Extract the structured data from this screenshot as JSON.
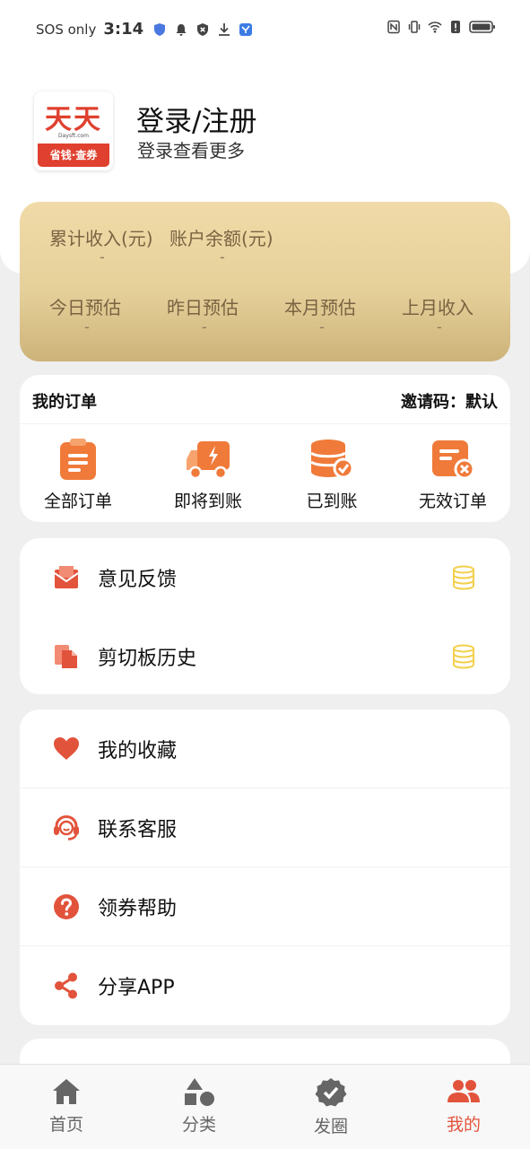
{
  "status_bar": {
    "carrier": "SOS only",
    "time": "3:14"
  },
  "profile": {
    "logo_text": "天天",
    "logo_small": "Daysft.com",
    "logo_band": "省钱·查券",
    "title": "登录/注册",
    "subtitle": "登录查看更多"
  },
  "earnings": {
    "total_income_label": "累计收入(元)",
    "total_income_value": "-",
    "balance_label": "账户余额(元)",
    "balance_value": "-",
    "stats": [
      {
        "label": "今日预估",
        "value": "-"
      },
      {
        "label": "昨日预估",
        "value": "-"
      },
      {
        "label": "本月预估",
        "value": "-"
      },
      {
        "label": "上月收入",
        "value": "-"
      }
    ]
  },
  "orders": {
    "title": "我的订单",
    "invite_code": "邀请码：默认",
    "items": [
      {
        "label": "全部订单",
        "icon": "order-list-icon"
      },
      {
        "label": "即将到账",
        "icon": "delivery-truck-icon"
      },
      {
        "label": "已到账",
        "icon": "coins-check-icon"
      },
      {
        "label": "无效订单",
        "icon": "invalid-order-icon"
      }
    ]
  },
  "menu_group_1": [
    {
      "label": "意见反馈",
      "icon": "feedback-mail-icon"
    },
    {
      "label": "剪切板历史",
      "icon": "clipboard-icon"
    }
  ],
  "menu_group_2": [
    {
      "label": "我的收藏",
      "icon": "heart-icon"
    },
    {
      "label": "联系客服",
      "icon": "headset-icon"
    },
    {
      "label": "领券帮助",
      "icon": "help-icon"
    },
    {
      "label": "分享APP",
      "icon": "share-icon"
    }
  ],
  "tabbar": [
    {
      "label": "首页",
      "icon": "home-icon"
    },
    {
      "label": "分类",
      "icon": "category-shapes-icon"
    },
    {
      "label": "发圈",
      "icon": "verified-badge-icon"
    },
    {
      "label": "我的",
      "icon": "users-icon",
      "active": true
    }
  ],
  "colors": {
    "accent": "#e2533c",
    "gold_card": "#e6d09a",
    "coin": "#f2d04b"
  }
}
